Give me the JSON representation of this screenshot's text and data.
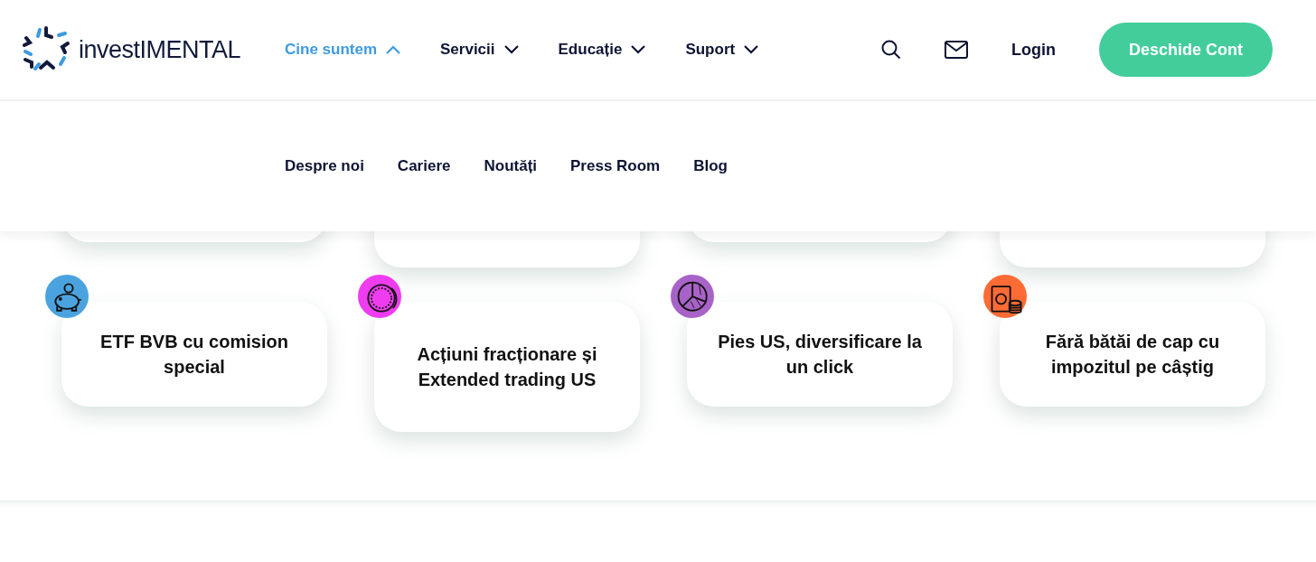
{
  "logo": {
    "text": "investIMENTAL"
  },
  "nav": [
    {
      "label": "Cine suntem",
      "selected": true,
      "expanded": true
    },
    {
      "label": "Servicii",
      "selected": false,
      "expanded": false
    },
    {
      "label": "Educație",
      "selected": false,
      "expanded": false
    },
    {
      "label": "Suport",
      "selected": false,
      "expanded": false
    }
  ],
  "actions": {
    "login": "Login",
    "cta": "Deschide Cont"
  },
  "submenu": [
    "Despre noi",
    "Cariere",
    "Noutăți",
    "Press Room",
    "Blog"
  ],
  "features": [
    {
      "kind": "piggy",
      "color": "#4aa3df",
      "text": "ETF BVB cu comision special"
    },
    {
      "kind": "coin",
      "color": "#f03cf0",
      "text": "Acțiuni fracționare și Extended trading US"
    },
    {
      "kind": "pie",
      "color": "#a863c8",
      "text": "Pies US, diversificare la un click"
    },
    {
      "kind": "money",
      "color": "#ff6b35",
      "text": "Fără bătăi de cap cu impozitul pe câștig"
    }
  ]
}
